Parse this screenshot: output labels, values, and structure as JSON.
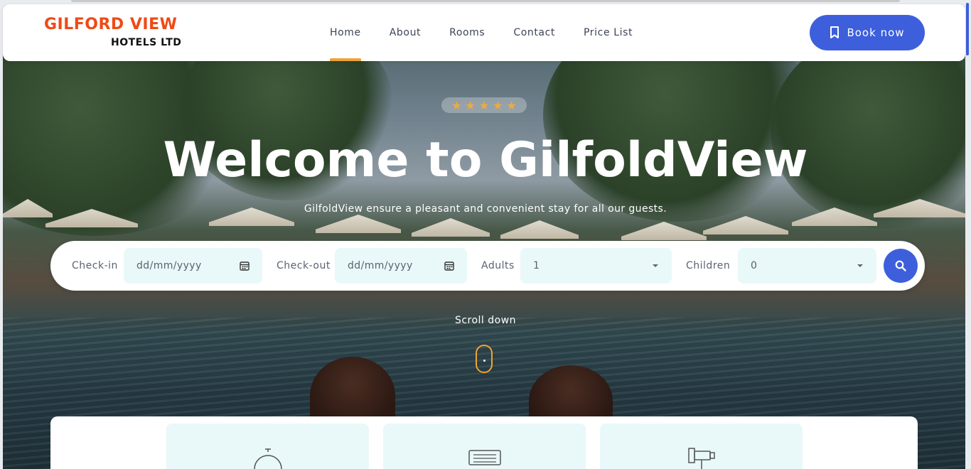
{
  "brand": {
    "name_top": "GILFORD VIEW",
    "name_bottom": "HOTELS LTD",
    "accent": "#ef4a16"
  },
  "nav": {
    "items": [
      {
        "label": "Home",
        "active": true
      },
      {
        "label": "About",
        "active": false
      },
      {
        "label": "Rooms",
        "active": false
      },
      {
        "label": "Contact",
        "active": false
      },
      {
        "label": "Price List",
        "active": false
      }
    ]
  },
  "header": {
    "book_label": "Book now",
    "book_icon": "bookmark-icon"
  },
  "hero": {
    "rating_stars": 5,
    "title": "Welcome to GilfoldView",
    "subtitle": "GilfoldView ensure a pleasant and convenient stay for all our guests.",
    "scroll_label": "Scroll down"
  },
  "search": {
    "checkin_label": "Check-in",
    "checkin_placeholder": "dd/mm/yyyy",
    "checkout_label": "Check-out",
    "checkout_placeholder": "dd/mm/yyyy",
    "adults_label": "Adults",
    "adults_value": "1",
    "children_label": "Children",
    "children_value": "0",
    "button_icon": "search-icon"
  },
  "features": [
    {
      "icon": "room-service-icon"
    },
    {
      "icon": "air-conditioner-icon"
    },
    {
      "icon": "cctv-camera-icon"
    }
  ],
  "colors": {
    "primary": "#3e5fdc",
    "accent": "#f0a236",
    "field_bg": "#e9f8f8"
  }
}
